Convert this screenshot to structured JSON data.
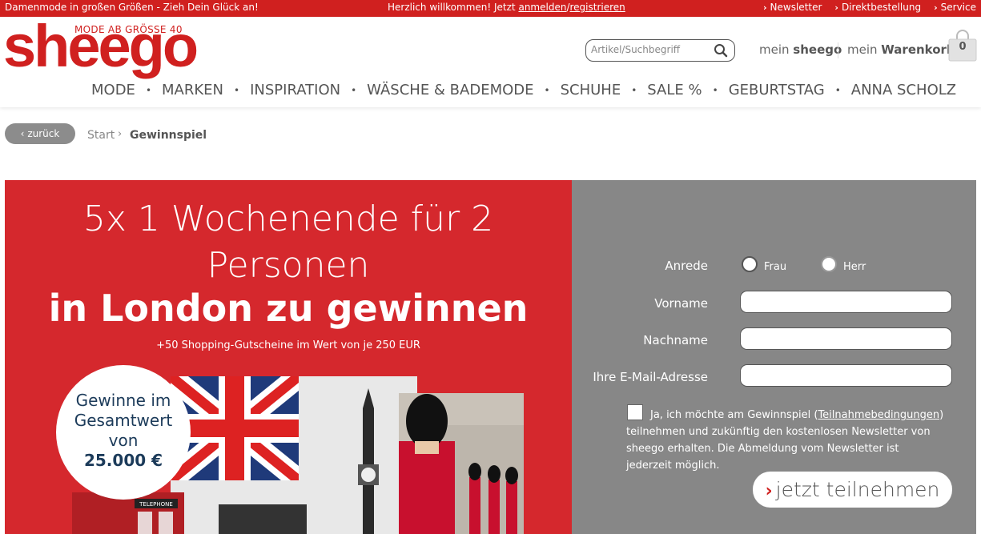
{
  "topbar": {
    "left_text": "Damenmode in großen Größen - Zieh Dein Glück an!",
    "welcome": "Herzlich willkommen! Jetzt",
    "login": "anmelden",
    "sep": "/",
    "register": "registrieren",
    "links": [
      "Newsletter",
      "Direktbestellung",
      "Service"
    ]
  },
  "header": {
    "logo": "sheego",
    "logo_tag": "MODE AB GRÖSSE 40",
    "search_placeholder": "Artikel/Suchbegriff",
    "account_prefix": "mein",
    "account_brand": "sheego",
    "cart_prefix": "mein",
    "cart_label": "Warenkorb",
    "cart_count": "0"
  },
  "nav": [
    "MODE",
    "MARKEN",
    "INSPIRATION",
    "WÄSCHE & BADEMODE",
    "SCHUHE",
    "SALE %",
    "GEBURTSTAG",
    "ANNA SCHOLZ"
  ],
  "breadcrumb": {
    "back": "zurück",
    "start": "Start",
    "current": "Gewinnspiel"
  },
  "promo": {
    "headline_1": "5x 1 Wochenende für 2",
    "headline_2": "Personen",
    "headline_3": "in London zu gewinnen",
    "subline": "+50 Shopping-Gutscheine im Wert von je 250 EUR",
    "circle_1": "Gewinne im",
    "circle_2": "Gesamtwert",
    "circle_3": "von",
    "circle_4": "25.000 €",
    "phone_sign": "TELEPHONE"
  },
  "form": {
    "salutation_label": "Anrede",
    "option_frau": "Frau",
    "option_herr": "Herr",
    "firstname_label": "Vorname",
    "lastname_label": "Nachname",
    "email_label": "Ihre E-Mail-Adresse",
    "legal_1": "Ja, ich möchte am Gewinnspiel (",
    "legal_link": "Teilnahmebedingungen",
    "legal_2": ") teilnehmen und zukünftig den kostenlosen Newsletter von sheego erhalten. Die Abmeldung vom Newsletter ist jederzeit möglich.",
    "submit": "jetzt teilnehmen"
  },
  "colors": {
    "brand_red": "#d0201f",
    "promo_red": "#d5282d",
    "form_gray": "#878787"
  }
}
